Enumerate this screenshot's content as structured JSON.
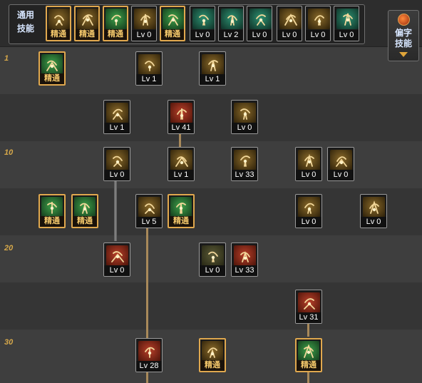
{
  "header": {
    "common_skills_label": "通用\n技能",
    "side_skills_label": "偏字\n技能",
    "common_skills": [
      {
        "icon": "sit-up-icon",
        "caption": "精通",
        "elite": true
      },
      {
        "icon": "leap-icon",
        "caption": "精通",
        "elite": true
      },
      {
        "icon": "stance-icon",
        "caption": "精通",
        "elite": true
      },
      {
        "icon": "wing-emblem-icon",
        "caption": "Lv 0",
        "elite": false
      },
      {
        "icon": "target-reticle-icon",
        "caption": "精通",
        "elite": true
      },
      {
        "icon": "crosshair-icon",
        "caption": "Lv 0",
        "elite": false
      },
      {
        "icon": "crouch-figure-icon",
        "caption": "Lv 2",
        "elite": false
      },
      {
        "icon": "cooking-pot-icon",
        "caption": "Lv 0",
        "elite": false
      },
      {
        "icon": "eye-ring-icon",
        "caption": "Lv 0",
        "elite": false
      },
      {
        "icon": "power-up-figure-icon",
        "caption": "Lv 0",
        "elite": false
      },
      {
        "icon": "running-figure-icon",
        "caption": "Lv 0",
        "elite": false
      }
    ]
  },
  "tree": {
    "row_labels": [
      "1",
      "10",
      "20",
      "30"
    ],
    "skills": [
      {
        "icon": "crossed-arrows-icon",
        "caption": "精通",
        "elite": true
      },
      {
        "icon": "swirl-arrow-icon",
        "caption": "Lv 1",
        "elite": false
      },
      {
        "icon": "flame-spin-icon",
        "caption": "Lv 1",
        "elite": false
      },
      {
        "icon": "starburst-icon",
        "caption": "Lv 1",
        "elite": false
      },
      {
        "icon": "red-bullets-icon",
        "caption": "Lv 41",
        "elite": false
      },
      {
        "icon": "gun-blast-icon",
        "caption": "Lv 0",
        "elite": false
      },
      {
        "icon": "claw-slash-icon",
        "caption": "Lv 0",
        "elite": false
      },
      {
        "icon": "flame-bullet-icon",
        "caption": "Lv 1",
        "elite": false
      },
      {
        "icon": "lightning-strike-icon",
        "caption": "Lv 33",
        "elite": false
      },
      {
        "icon": "crate-arrow-icon",
        "caption": "Lv 0",
        "elite": false
      },
      {
        "icon": "demon-face-icon",
        "caption": "Lv 0",
        "elite": false
      },
      {
        "icon": "green-rifle-icon",
        "caption": "精通",
        "elite": true
      },
      {
        "icon": "spread-shot-icon",
        "caption": "精通",
        "elite": true
      },
      {
        "icon": "fire-ground-icon",
        "caption": "Lv 5",
        "elite": false
      },
      {
        "icon": "green-cannon-icon",
        "caption": "精通",
        "elite": true
      },
      {
        "icon": "kick-figure-icon",
        "caption": "Lv 0",
        "elite": false
      },
      {
        "icon": "grenade-icon",
        "caption": "Lv 0",
        "elite": false
      },
      {
        "icon": "red-power-icon",
        "caption": "Lv 0",
        "elite": false
      },
      {
        "icon": "rocket-icon",
        "caption": "Lv 0",
        "elite": false
      },
      {
        "icon": "red-eye-icon",
        "caption": "Lv 33",
        "elite": false
      },
      {
        "icon": "red-hand-cannon-icon",
        "caption": "Lv 31",
        "elite": false
      },
      {
        "icon": "red-rifle-icon",
        "caption": "Lv 28",
        "elite": false
      },
      {
        "icon": "gatling-plus-icon",
        "caption": "精通",
        "elite": true
      },
      {
        "icon": "green-gear-icon",
        "caption": "精通",
        "elite": true
      }
    ]
  }
}
